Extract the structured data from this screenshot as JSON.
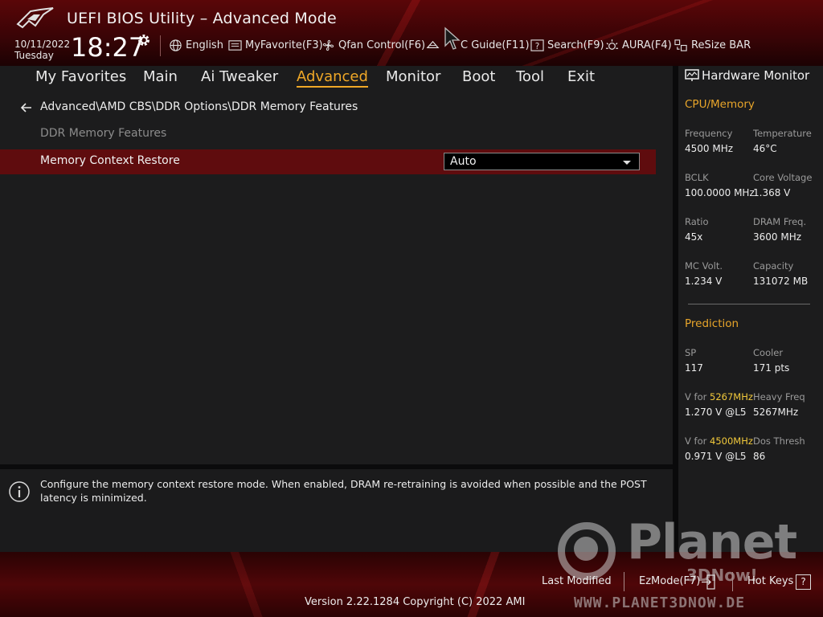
{
  "header": {
    "title": "UEFI BIOS Utility – Advanced Mode",
    "date": "10/11/2022",
    "weekday": "Tuesday",
    "time": "18:27",
    "toolbar": {
      "language": "English",
      "myfavorite": "MyFavorite(F3)",
      "qfan": "Qfan Control(F6)",
      "oc_guide": "C Guide(F11)",
      "search": "Search(F9)",
      "aura": "AURA(F4)",
      "resize_bar": "ReSize BAR"
    }
  },
  "menu": {
    "items": [
      "My Favorites",
      "Main",
      "Ai Tweaker",
      "Advanced",
      "Monitor",
      "Boot",
      "Tool",
      "Exit"
    ],
    "active": "Advanced"
  },
  "main": {
    "breadcrumb": "Advanced\\AMD CBS\\DDR Options\\DDR Memory Features",
    "section_title": "DDR Memory Features",
    "settings": [
      {
        "label": "Memory Context Restore",
        "value": "Auto"
      }
    ],
    "help_text": "Configure the memory context restore mode. When enabled, DRAM re-retraining is avoided when possible and the POST latency is minimized."
  },
  "hardware_monitor": {
    "title": "Hardware Monitor",
    "cpu_memory": {
      "heading": "CPU/Memory",
      "items": [
        {
          "label": "Frequency",
          "value": "4500 MHz"
        },
        {
          "label": "Temperature",
          "value": "46°C"
        },
        {
          "label": "BCLK",
          "value": "100.0000 MHz"
        },
        {
          "label": "Core Voltage",
          "value": "1.368 V"
        },
        {
          "label": "Ratio",
          "value": "45x"
        },
        {
          "label": "DRAM Freq.",
          "value": "3600 MHz"
        },
        {
          "label": "MC Volt.",
          "value": "1.234 V"
        },
        {
          "label": "Capacity",
          "value": "131072 MB"
        }
      ]
    },
    "prediction": {
      "heading": "Prediction",
      "sp_label": "SP",
      "sp_value": "117",
      "cooler_label": "Cooler",
      "cooler_value": "171 pts",
      "v1_prefix": "V for ",
      "v1_freq": "5267MHz",
      "v1_value": "1.270 V @L5",
      "heavy_label": "Heavy Freq",
      "heavy_value": "5267MHz",
      "v2_prefix": "V for ",
      "v2_freq": "4500MHz",
      "v2_value": "0.971 V @L5",
      "dos_label": "Dos Thresh",
      "dos_value": "86"
    }
  },
  "footer": {
    "last_modified": "Last Modified",
    "ezmode": "EzMode(F7)",
    "hotkeys": "Hot Keys",
    "hotkeys_key": "?",
    "version": "Version 2.22.1284 Copyright (C) 2022 AMI"
  },
  "watermark": {
    "word": "Planet",
    "sub": "3DNow!",
    "url": "WWW.PLANET3DNOW.DE"
  },
  "colors": {
    "accent": "#f0a827",
    "selected_row": "#5f0c0e",
    "highlight_freq": "#f2c93b"
  }
}
